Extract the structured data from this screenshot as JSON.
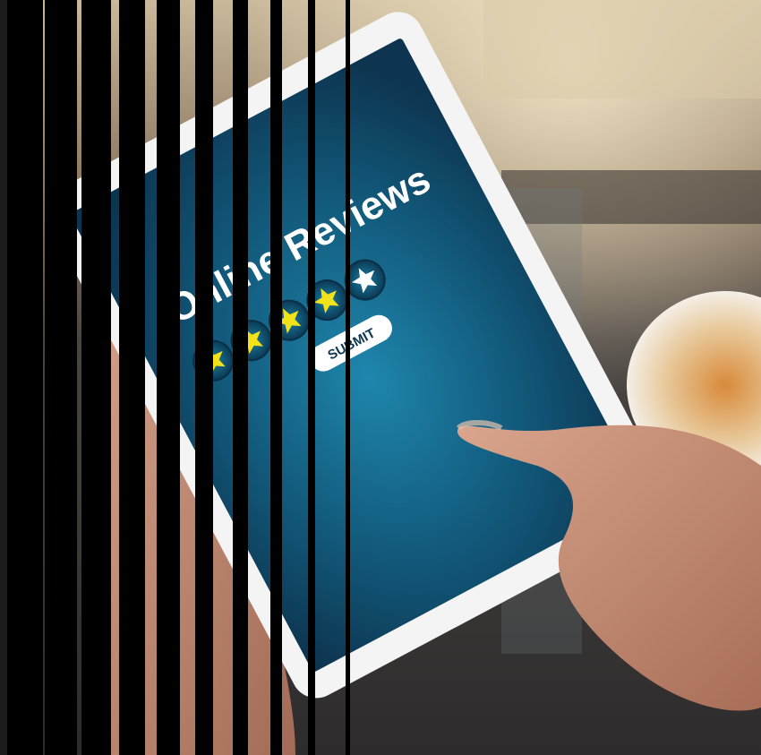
{
  "photo": {
    "screen_title": "Online Reviews",
    "submit_label": "SUBMIT",
    "rating": {
      "filled_stars": 4,
      "total_stars": 5
    },
    "colors": {
      "screen_center": "#1f86ad",
      "screen_edge": "#0d3550",
      "star_filled": "#f2e21a",
      "star_empty": "#ffffff",
      "tablet_frame": "#f4f4f4",
      "skin": "#c8917a"
    }
  },
  "overlay": {
    "shutter_bars": 10,
    "bar_color": "#000000"
  }
}
